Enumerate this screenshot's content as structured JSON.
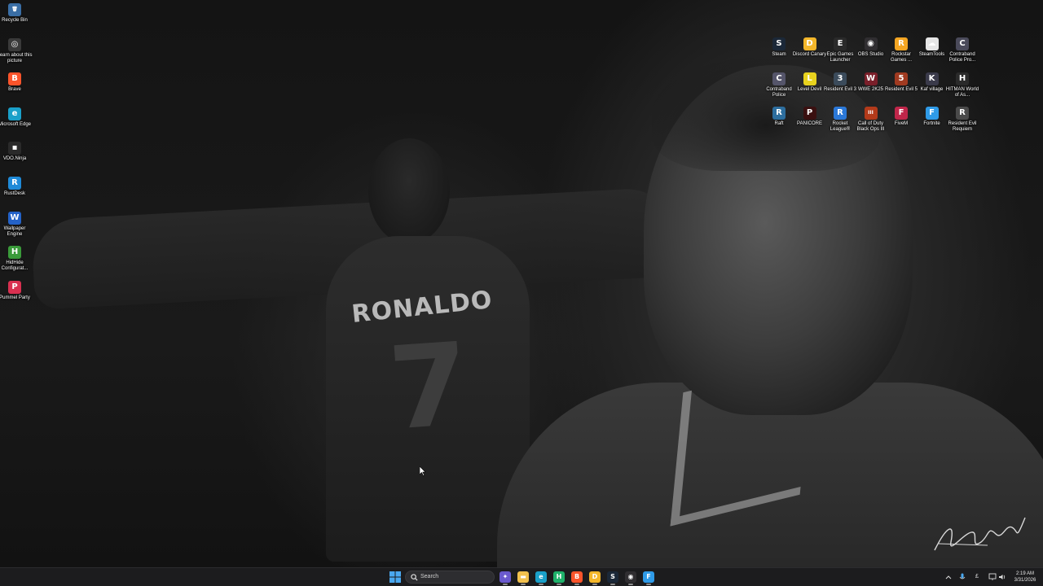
{
  "wallpaper": {
    "jersey_name": "RONALDO",
    "jersey_number": "7"
  },
  "desktop_left_icons": [
    {
      "label": "Recycle Bin",
      "icon": "recycle-bin-icon",
      "color": "#3a6ea5",
      "glyph": "🗑"
    },
    {
      "label": "Learn about this picture",
      "icon": "camera-info-icon",
      "color": "#3a3a3a",
      "glyph": "◎"
    },
    {
      "label": "Brave",
      "icon": "brave-icon",
      "color": "#fb542b",
      "glyph": "B"
    },
    {
      "label": "Microsoft Edge",
      "icon": "edge-icon",
      "color": "#1aa0c9",
      "glyph": "e"
    },
    {
      "label": "VDO.Ninja",
      "icon": "vdo-ninja-icon",
      "color": "#2a2a2a",
      "glyph": "▪"
    },
    {
      "label": "RustDesk",
      "icon": "rustdesk-icon",
      "color": "#1f8ad8",
      "glyph": "R"
    },
    {
      "label": "Wallpaper Engine",
      "icon": "wallpaper-engine-icon",
      "color": "#2462c7",
      "glyph": "W"
    },
    {
      "label": "HidHide Configurat...",
      "icon": "hidhide-icon",
      "color": "#3a9b3a",
      "glyph": "H"
    },
    {
      "label": "Pummel Party",
      "icon": "pummel-party-icon",
      "color": "#d93050",
      "glyph": "P"
    }
  ],
  "desktop_right_icons": [
    {
      "label": "Steam",
      "icon": "steam-icon",
      "color": "#1b2838",
      "glyph": "S"
    },
    {
      "label": "Discord Canary",
      "icon": "discord-canary-icon",
      "color": "#f4b72a",
      "glyph": "D"
    },
    {
      "label": "Epic Games Launcher",
      "icon": "epic-games-icon",
      "color": "#2a2a2a",
      "glyph": "E"
    },
    {
      "label": "OBS Studio",
      "icon": "obs-icon",
      "color": "#302e31",
      "glyph": "◉"
    },
    {
      "label": "Rockstar Games ...",
      "icon": "rockstar-icon",
      "color": "#f5a623",
      "glyph": "R"
    },
    {
      "label": "SteamTools",
      "icon": "steamtools-icon",
      "color": "#e6e6e6",
      "glyph": "☁"
    },
    {
      "label": "Contraband Police Pro...",
      "icon": "contraband-police-pro-icon",
      "color": "#4a4a5a",
      "glyph": "C"
    },
    {
      "label": "Contraband Police",
      "icon": "contraband-police-icon",
      "color": "#55556a",
      "glyph": "C"
    },
    {
      "label": "Level Devil",
      "icon": "level-devil-icon",
      "color": "#e8d21e",
      "glyph": "L"
    },
    {
      "label": "Resident Evil 3",
      "icon": "resident-evil-3-icon",
      "color": "#3b4b5b",
      "glyph": "3"
    },
    {
      "label": "WWE 2K25",
      "icon": "wwe-2k25-icon",
      "color": "#7a1f2a",
      "glyph": "W"
    },
    {
      "label": "Resident Evil 5",
      "icon": "resident-evil-5-icon",
      "color": "#a03a20",
      "glyph": "5"
    },
    {
      "label": "Kaf village",
      "icon": "kaf-village-icon",
      "color": "#3a3a4a",
      "glyph": "K"
    },
    {
      "label": "HITMAN World of As...",
      "icon": "hitman-icon",
      "color": "#2a2a2a",
      "glyph": "H"
    },
    {
      "label": "Raft",
      "icon": "raft-icon",
      "color": "#2d6e9e",
      "glyph": "R"
    },
    {
      "label": "PANICORE",
      "icon": "panicore-icon",
      "color": "#3a1010",
      "glyph": "P"
    },
    {
      "label": "Rocket League®",
      "icon": "rocket-league-icon",
      "color": "#2b78d8",
      "glyph": "R"
    },
    {
      "label": "Call of Duty Black Ops III",
      "icon": "call-of-duty-icon",
      "color": "#b33a1a",
      "glyph": "III"
    },
    {
      "label": "FiveM",
      "icon": "fivem-icon",
      "color": "#c0264a",
      "glyph": "F"
    },
    {
      "label": "Fortnite",
      "icon": "fortnite-icon",
      "color": "#2f9be8",
      "glyph": "F"
    },
    {
      "label": "Resident Evil Requiem",
      "icon": "resident-evil-requiem-icon",
      "color": "#4a4a4a",
      "glyph": "R"
    }
  ],
  "taskbar": {
    "search_placeholder": "Search",
    "apps": [
      {
        "name": "copilot",
        "icon": "copilot-icon",
        "color": "#6a5acd",
        "glyph": "✦"
      },
      {
        "name": "file-explorer",
        "icon": "folder-icon",
        "color": "#f2c14e",
        "glyph": "▬"
      },
      {
        "name": "edge",
        "icon": "edge-icon",
        "color": "#1aa0c9",
        "glyph": "e"
      },
      {
        "name": "app-green",
        "icon": "green-app-icon",
        "color": "#1fb26b",
        "glyph": "H"
      },
      {
        "name": "brave",
        "icon": "brave-icon",
        "color": "#fb542b",
        "glyph": "B"
      },
      {
        "name": "discord-canary",
        "icon": "discord-canary-icon",
        "color": "#f4b72a",
        "glyph": "D"
      },
      {
        "name": "steam",
        "icon": "steam-icon",
        "color": "#1b2838",
        "glyph": "S"
      },
      {
        "name": "obs",
        "icon": "obs-icon",
        "color": "#302e31",
        "glyph": "◉"
      },
      {
        "name": "fortnite",
        "icon": "fortnite-icon",
        "color": "#2f9be8",
        "glyph": "F"
      }
    ],
    "tray_language": "£",
    "time": "2:19 AM",
    "date": "3/31/2026"
  }
}
